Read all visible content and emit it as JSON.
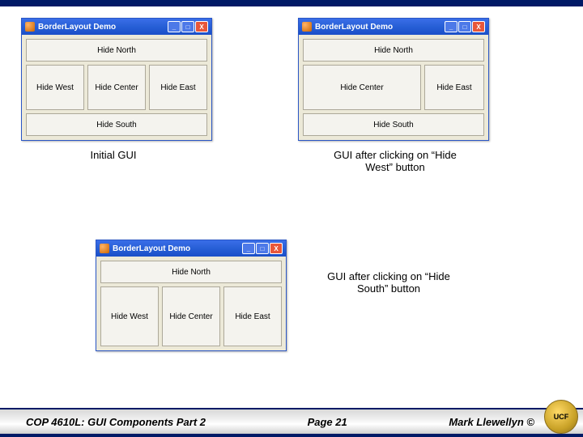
{
  "border_top_color": "#001a66",
  "windows": {
    "initial": {
      "title": "BorderLayout Demo",
      "buttons": {
        "north": "Hide North",
        "west": "Hide West",
        "center": "Hide Center",
        "east": "Hide East",
        "south": "Hide South"
      }
    },
    "after_hide_west": {
      "title": "BorderLayout Demo",
      "buttons": {
        "north": "Hide North",
        "center": "Hide Center",
        "east": "Hide East",
        "south": "Hide South"
      }
    },
    "after_hide_south": {
      "title": "BorderLayout Demo",
      "buttons": {
        "north": "Hide North",
        "west": "Hide West",
        "center": "Hide Center",
        "east": "Hide East"
      }
    }
  },
  "captions": {
    "initial": "Initial GUI",
    "after_west": "GUI after clicking on “Hide West” button",
    "after_south": "GUI after clicking on “Hide South” button"
  },
  "footer": {
    "course": "COP 4610L: GUI Components Part 2",
    "page": "Page 21",
    "author": "Mark Llewellyn ©",
    "logo_text": "UCF"
  },
  "win_controls": {
    "min": "_",
    "max": "□",
    "close": "X"
  }
}
